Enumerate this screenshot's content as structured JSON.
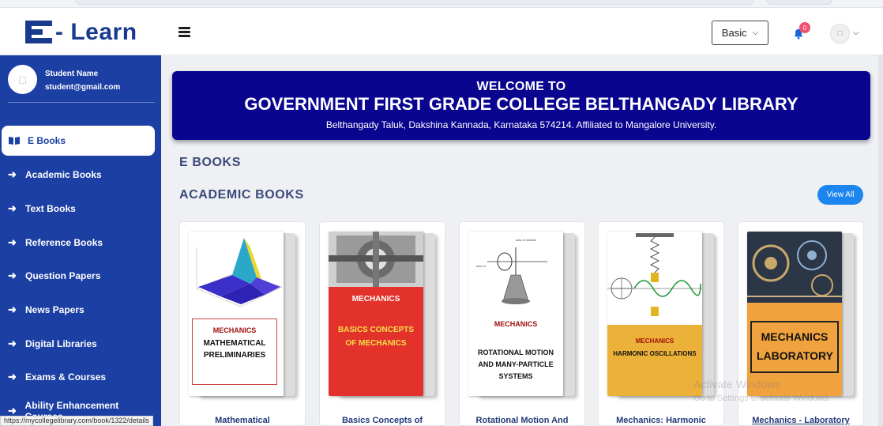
{
  "app": {
    "logo_text": "- Learn",
    "basic_label": "Basic",
    "notification_count": "0"
  },
  "profile": {
    "name": "Student Name",
    "email": "student@gmail.com"
  },
  "sidebar": {
    "items": [
      {
        "label": "E Books",
        "icon": "book-icon",
        "active": true
      },
      {
        "label": "Academic Books",
        "icon": "arrow-right-icon"
      },
      {
        "label": "Text Books",
        "icon": "arrow-right-icon"
      },
      {
        "label": "Reference Books",
        "icon": "arrow-right-icon"
      },
      {
        "label": "Question Papers",
        "icon": "arrow-right-icon"
      },
      {
        "label": "News Papers",
        "icon": "arrow-right-icon"
      },
      {
        "label": "Digital Libraries",
        "icon": "arrow-right-icon"
      },
      {
        "label": "Exams & Courses",
        "icon": "arrow-right-icon"
      },
      {
        "label": "Ability Enhancement Courses",
        "icon": "arrow-right-icon"
      }
    ]
  },
  "status_url": "https://mycollegelibrary.com/book/1322/details",
  "welcome": {
    "line1": "WELCOME TO",
    "line2": "GOVERNMENT FIRST GRADE COLLEGE BELTHANGADY LIBRARY",
    "line3": "Belthangady Taluk, Dakshina Kannada, Karnataka 574214. Affiliated to Mangalore University."
  },
  "sections": {
    "ebooks_title": "E BOOKS",
    "academic_title": "ACADEMIC BOOKS",
    "view_all": "View All"
  },
  "books": [
    {
      "title": "Mathematical",
      "cover_subject": "MECHANICS",
      "cover_title": "MATHEMATICAL PRELIMINARIES"
    },
    {
      "title": "Basics Concepts of",
      "cover_subject": "MECHANICS",
      "cover_title": "BASICS CONCEPTS OF MECHANICS"
    },
    {
      "title": "Rotational Motion And",
      "cover_subject": "MECHANICS",
      "cover_title": "ROTATIONAL MOTION AND MANY-PARTICLE SYSTEMS"
    },
    {
      "title": "Mechanics: Harmonic",
      "cover_subject": "MECHANICS",
      "cover_title": "HARMONIC OSCILLATIONS"
    },
    {
      "title": "Mechanics - Laboratory",
      "cover_subject": "",
      "cover_title": "MECHANICS LABORATORY"
    }
  ],
  "watermark": {
    "line1": "Activate Windows",
    "line2": "Go to Settings to activate Windows."
  },
  "colors": {
    "sidebar": "#1b3fa3",
    "banner": "#0a058f",
    "accent": "#1c86ee"
  }
}
